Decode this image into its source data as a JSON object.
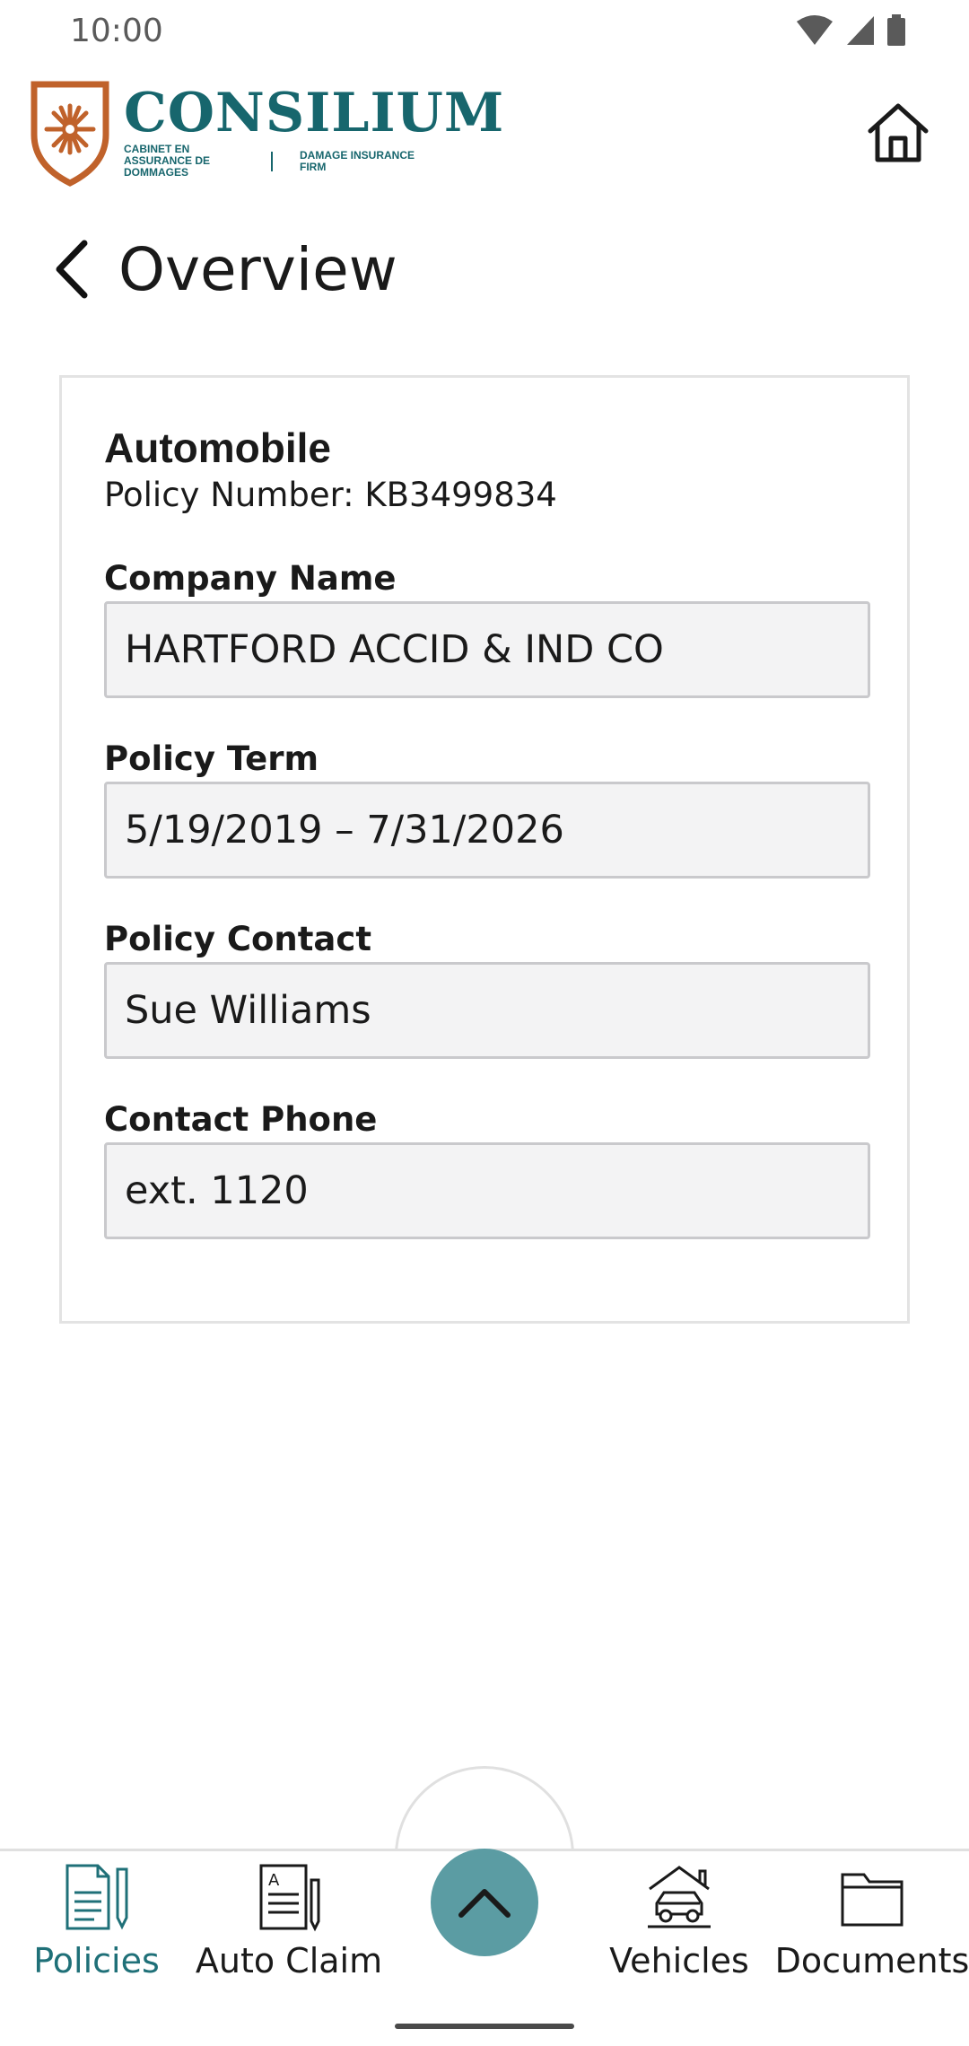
{
  "status_bar": {
    "time": "10:00"
  },
  "header": {
    "logo_word": "CONSILIUM",
    "logo_tag_fr": "CABINET EN ASSURANCE DE DOMMAGES",
    "logo_tag_en": "DAMAGE INSURANCE FIRM"
  },
  "page": {
    "title": "Overview"
  },
  "policy": {
    "type": "Automobile",
    "number_label": "Policy Number:",
    "number": "KB3499834",
    "fields": [
      {
        "label": "Company Name",
        "value": "HARTFORD ACCID & IND CO"
      },
      {
        "label": "Policy Term",
        "value": "5/19/2019 – 7/31/2026"
      },
      {
        "label": "Policy Contact",
        "value": "Sue Williams"
      },
      {
        "label": "Contact Phone",
        "value": "ext. 1120"
      }
    ]
  },
  "bottom_nav": {
    "items": [
      {
        "label": "Policies",
        "icon": "policies-icon",
        "active": true
      },
      {
        "label": "Auto Claim",
        "icon": "auto-claim-icon",
        "active": false
      },
      {
        "label": "Vehicles",
        "icon": "vehicles-icon",
        "active": false
      },
      {
        "label": "Documents",
        "icon": "documents-icon",
        "active": false
      }
    ],
    "fab_icon": "chevron-up-icon"
  },
  "colors": {
    "brand": "#17666d",
    "accent_orange": "#c0622b",
    "fab": "#5b9ca3",
    "active_nav": "#1f7078",
    "field_bg": "#f3f3f4"
  }
}
